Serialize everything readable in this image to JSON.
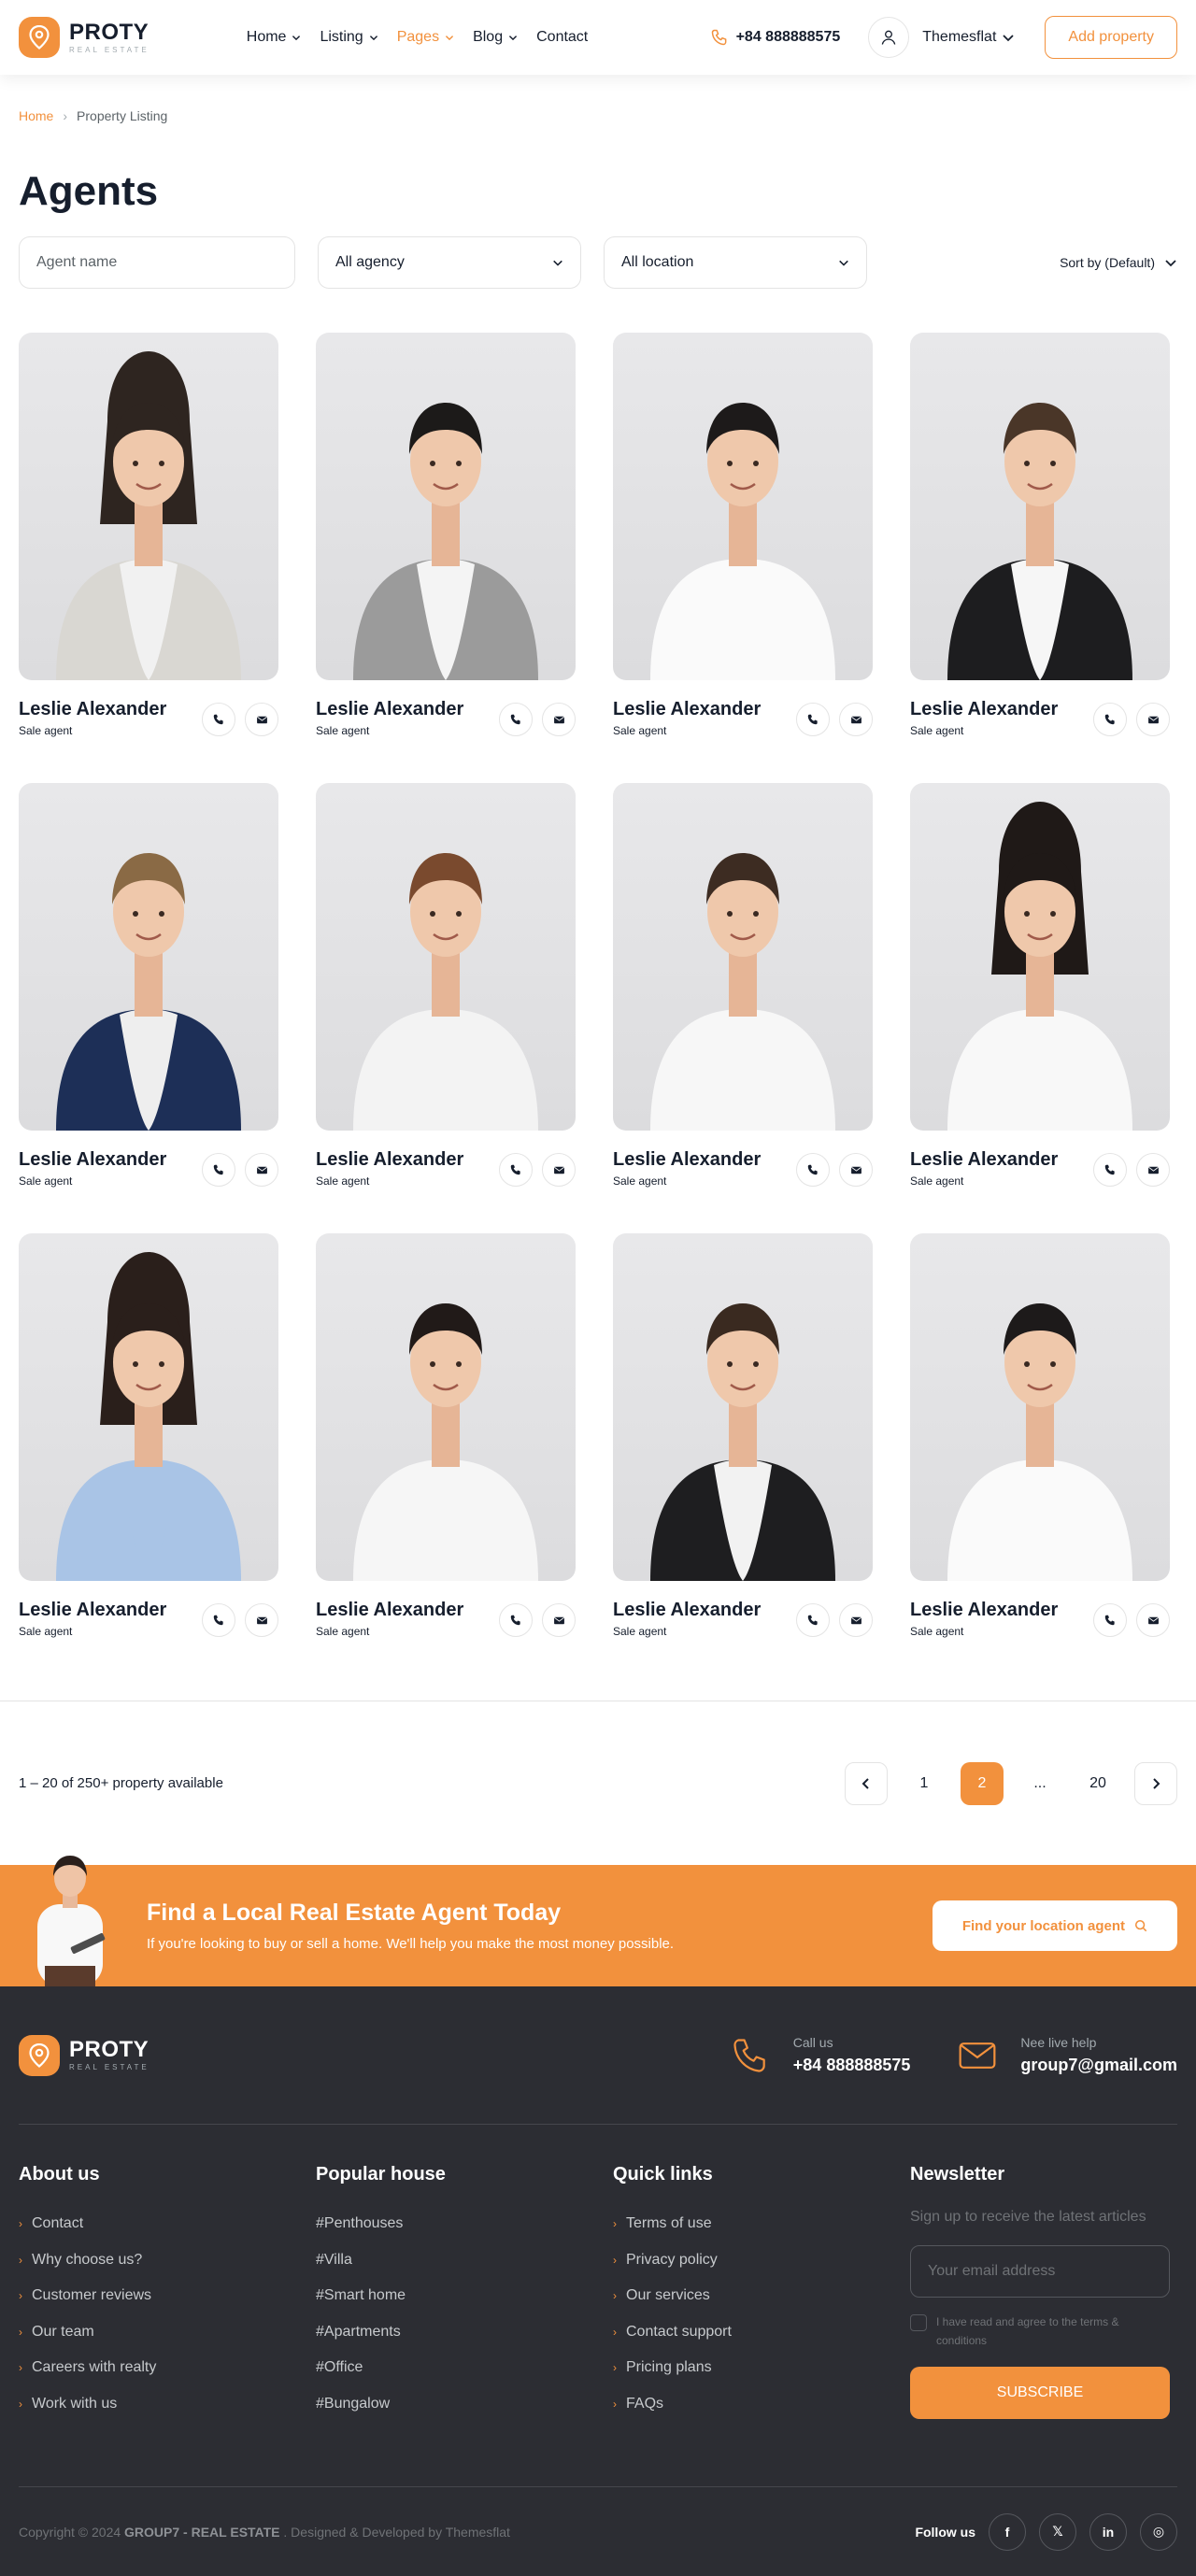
{
  "header": {
    "logo_name": "PROTY",
    "logo_sub": "REAL ESTATE",
    "nav": [
      {
        "label": "Home",
        "dropdown": true
      },
      {
        "label": "Listing",
        "dropdown": true
      },
      {
        "label": "Pages",
        "dropdown": true,
        "active": true
      },
      {
        "label": "Blog",
        "dropdown": true
      },
      {
        "label": "Contact",
        "dropdown": false
      }
    ],
    "phone": "+84 888888575",
    "user_name": "Themesflat",
    "add_property": "Add property"
  },
  "breadcrumb": {
    "home": "Home",
    "current": "Property Listing"
  },
  "page_title": "Agents",
  "filters": {
    "agent_placeholder": "Agent name",
    "agency": "All agency",
    "location": "All location",
    "sort": "Sort by (Default)"
  },
  "agents": [
    {
      "name": "Leslie Alexander",
      "role": "Sale agent",
      "shirt": "#f1f1f1",
      "jacket": "#d9d7d2",
      "hair": "#2e2520",
      "long_hair": true
    },
    {
      "name": "Leslie Alexander",
      "role": "Sale agent",
      "shirt": "#f4f4f4",
      "jacket": "#9b9b9b",
      "hair": "#1c1a19",
      "long_hair": false
    },
    {
      "name": "Leslie Alexander",
      "role": "Sale agent",
      "shirt": "#fafafa",
      "jacket": "#fafafa",
      "hair": "#1d1a1a",
      "long_hair": false
    },
    {
      "name": "Leslie Alexander",
      "role": "Sale agent",
      "shirt": "#f6f6f6",
      "jacket": "#1d1d1f",
      "hair": "#4a3628",
      "long_hair": false
    },
    {
      "name": "Leslie Alexander",
      "role": "Sale agent",
      "shirt": "#eeeeee",
      "jacket": "#1d2f57",
      "hair": "#8a6a45",
      "long_hair": false
    },
    {
      "name": "Leslie Alexander",
      "role": "Sale agent",
      "shirt": "#f3f3f3",
      "jacket": "#f3f3f3",
      "hair": "#7a4a2e",
      "long_hair": false
    },
    {
      "name": "Leslie Alexander",
      "role": "Sale agent",
      "shirt": "#f7f7f7",
      "jacket": "#f7f7f7",
      "hair": "#3d2c22",
      "long_hair": false
    },
    {
      "name": "Leslie Alexander",
      "role": "Sale agent",
      "shirt": "#f8f8f8",
      "jacket": "#f8f8f8",
      "hair": "#1f1917",
      "long_hair": true
    },
    {
      "name": "Leslie Alexander",
      "role": "Sale agent",
      "shirt": "#a9c4e6",
      "jacket": "#a9c4e6",
      "hair": "#2a1f1b",
      "long_hair": true
    },
    {
      "name": "Leslie Alexander",
      "role": "Sale agent",
      "shirt": "#f6f6f6",
      "jacket": "#f6f6f6",
      "hair": "#211a18",
      "long_hair": false
    },
    {
      "name": "Leslie Alexander",
      "role": "Sale agent",
      "shirt": "#f2f2f2",
      "jacket": "#1e1e20",
      "hair": "#3a2a20",
      "long_hair": false
    },
    {
      "name": "Leslie Alexander",
      "role": "Sale agent",
      "shirt": "#fafafa",
      "jacket": "#fafafa",
      "hair": "#1d1a1a",
      "long_hair": false
    }
  ],
  "pagination": {
    "info": "1 – 20 of 250+ property available",
    "pages": [
      "1",
      "2",
      "...",
      "20"
    ],
    "active": "2"
  },
  "banner": {
    "title": "Find a Local Real Estate Agent Today",
    "subtitle": "If you're looking to buy or sell a home. We'll help you make the most money possible.",
    "button": "Find your location agent"
  },
  "footer": {
    "logo_name": "PROTY",
    "logo_sub": "REAL ESTATE",
    "call_label": "Call us",
    "call_value": "+84 888888575",
    "help_label": "Nee live help",
    "help_value": "group7@gmail.com",
    "about_title": "About us",
    "about_links": [
      "Contact",
      "Why choose us?",
      "Customer reviews",
      "Our team",
      "Careers with realty",
      "Work with us"
    ],
    "popular_title": "Popular house",
    "popular_links": [
      "#Penthouses",
      "#Villa",
      "#Smart home",
      "#Apartments",
      "#Office",
      "#Bungalow"
    ],
    "quick_title": "Quick links",
    "quick_links": [
      "Terms of use",
      "Privacy policy",
      "Our services",
      "Contact support",
      "Pricing plans",
      "FAQs"
    ],
    "newsletter_title": "Newsletter",
    "newsletter_text": "Sign up to receive the latest articles",
    "email_placeholder": "Your email address",
    "agree_text": "I have read and agree to the terms & conditions",
    "subscribe": "SUBSCRIBE",
    "copyright_pre": "Copyright © 2024 ",
    "copyright_brand": "GROUP7 - REAL ESTATE",
    "copyright_post": " . Designed & Developed by Themesflat",
    "follow_label": "Follow us",
    "socials": [
      {
        "icon": "facebook-icon",
        "glyph": "f"
      },
      {
        "icon": "x-twitter-icon",
        "glyph": "𝕏"
      },
      {
        "icon": "linkedin-icon",
        "glyph": "in"
      },
      {
        "icon": "instagram-icon",
        "glyph": "◎"
      }
    ]
  },
  "colors": {
    "accent": "#f2913d",
    "text": "#161e2d",
    "footer_bg": "#2c2d33"
  }
}
